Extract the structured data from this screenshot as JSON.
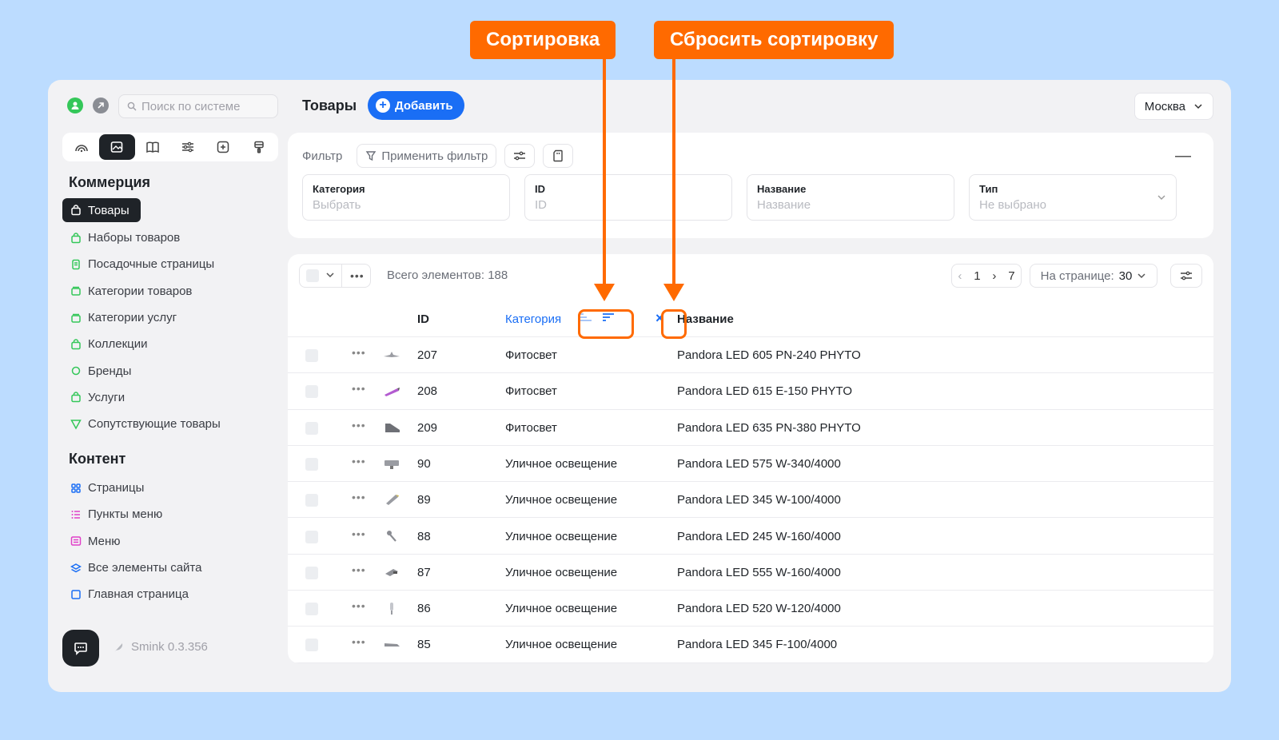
{
  "callouts": {
    "sort": "Сортировка",
    "reset_sort": "Сбросить сортировку"
  },
  "sidebar": {
    "search_placeholder": "Поиск по системе",
    "commerce_title": "Коммерция",
    "commerce_items": [
      {
        "label": "Товары",
        "icon": "bag-icon",
        "color": "#ffffff"
      },
      {
        "label": "Наборы товаров",
        "icon": "bag-icon",
        "color": "#34c759"
      },
      {
        "label": "Посадочные страницы",
        "icon": "page-icon",
        "color": "#34c759"
      },
      {
        "label": "Категории товаров",
        "icon": "folder-icon",
        "color": "#34c759"
      },
      {
        "label": "Категории услуг",
        "icon": "folder-icon",
        "color": "#34c759"
      },
      {
        "label": "Коллекции",
        "icon": "bag-icon",
        "color": "#34c759"
      },
      {
        "label": "Бренды",
        "icon": "badge-icon",
        "color": "#34c759"
      },
      {
        "label": "Услуги",
        "icon": "bag-icon",
        "color": "#34c759"
      },
      {
        "label": "Сопутствующие товары",
        "icon": "filter-icon",
        "color": "#34c759"
      }
    ],
    "content_title": "Контент",
    "content_items": [
      {
        "label": "Страницы",
        "icon": "grid-icon",
        "color": "#1a6ef5"
      },
      {
        "label": "Пункты меню",
        "icon": "list-icon",
        "color": "#e040c8"
      },
      {
        "label": "Меню",
        "icon": "menu-icon",
        "color": "#e040c8"
      },
      {
        "label": "Все элементы сайта",
        "icon": "layers-icon",
        "color": "#1a6ef5"
      },
      {
        "label": "Главная страница",
        "icon": "square-icon",
        "color": "#1a6ef5"
      }
    ],
    "version": "Smink 0.3.356"
  },
  "header": {
    "title": "Товары",
    "add_label": "Добавить",
    "city": "Москва"
  },
  "filter": {
    "label": "Фильтр",
    "apply_label": "Применить фильтр",
    "collapse": "—",
    "fields": [
      {
        "label": "Категория",
        "placeholder": "Выбрать",
        "dropdown": false
      },
      {
        "label": "ID",
        "placeholder": "ID",
        "dropdown": false
      },
      {
        "label": "Название",
        "placeholder": "Название",
        "dropdown": false
      },
      {
        "label": "Тип",
        "placeholder": "Не выбрано",
        "dropdown": true
      }
    ]
  },
  "table": {
    "total": "Всего элементов: 188",
    "pager": {
      "prev": "‹",
      "page": "1",
      "next": "›",
      "last": "7"
    },
    "per_page_label": "На странице:",
    "per_page_value": "30",
    "columns": {
      "id": "ID",
      "category": "Категория",
      "name": "Название"
    },
    "reset_icon": "×",
    "rows": [
      {
        "id": "207",
        "category": "Фитосвет",
        "name": "Pandora LED 605 PN-240 PHYTO"
      },
      {
        "id": "208",
        "category": "Фитосвет",
        "name": "Pandora LED 615 E-150 PHYTO"
      },
      {
        "id": "209",
        "category": "Фитосвет",
        "name": "Pandora LED 635 PN-380 PHYTO"
      },
      {
        "id": "90",
        "category": "Уличное освещение",
        "name": "Pandora LED 575 W-340/4000"
      },
      {
        "id": "89",
        "category": "Уличное освещение",
        "name": "Pandora LED 345 W-100/4000"
      },
      {
        "id": "88",
        "category": "Уличное освещение",
        "name": "Pandora LED 245 W-160/4000"
      },
      {
        "id": "87",
        "category": "Уличное освещение",
        "name": "Pandora LED 555 W-160/4000"
      },
      {
        "id": "86",
        "category": "Уличное освещение",
        "name": "Pandora LED 520 W-120/4000"
      },
      {
        "id": "85",
        "category": "Уличное освещение",
        "name": "Pandora LED 345 F-100/4000"
      }
    ]
  },
  "colors": {
    "accent": "#1a6ef5",
    "callout": "#ff6a00",
    "dark": "#1f2328"
  }
}
